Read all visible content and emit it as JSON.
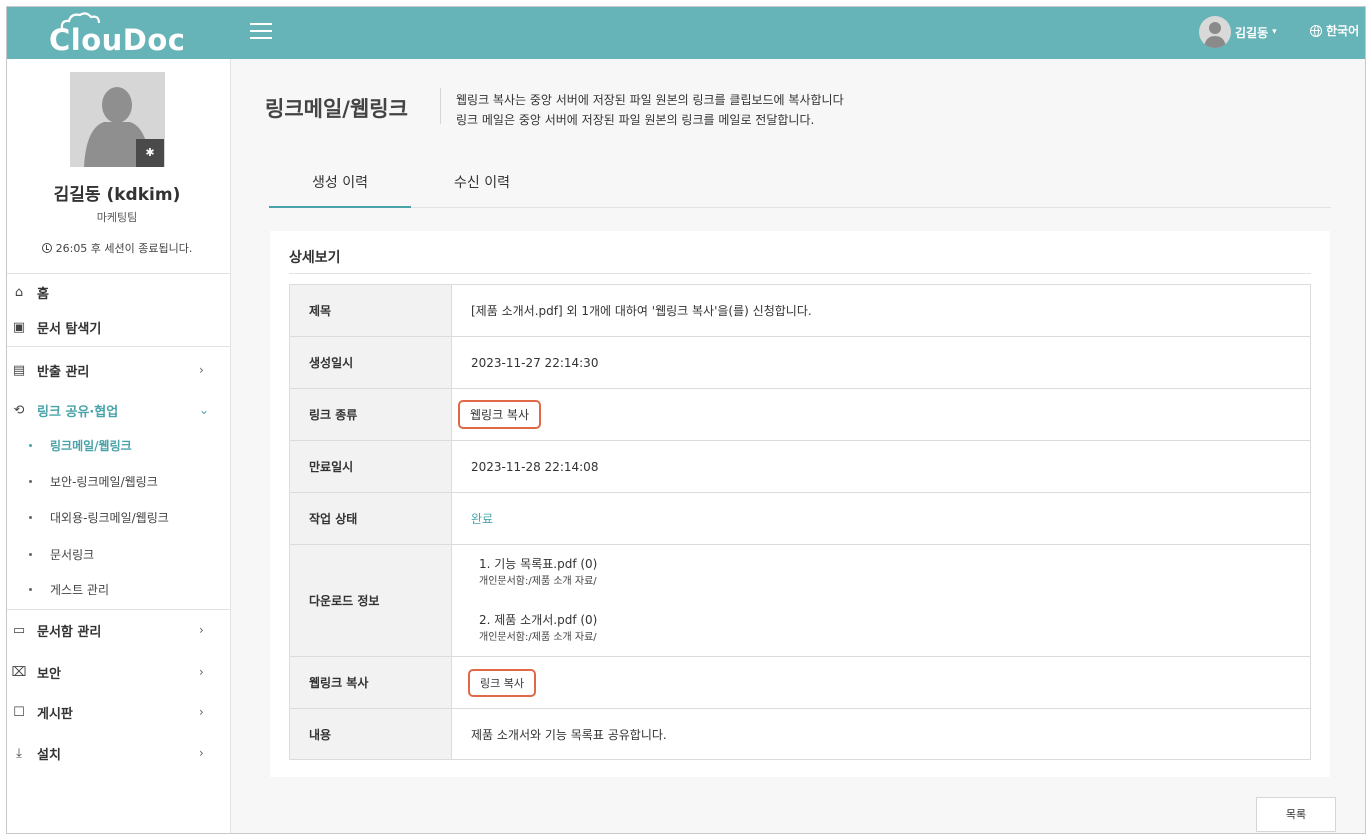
{
  "header": {
    "logo_text": "ClouDoc",
    "user_name": "김길동",
    "user_caret": "▾",
    "language": "한국어"
  },
  "profile": {
    "name": "김길동 (kdkim)",
    "team": "마케팅팀",
    "session_text": "26:05 후 세션이 종료됩니다.",
    "gear_icon": "gear-icon"
  },
  "sidebar": {
    "items": [
      {
        "label": "홈",
        "icon": "home-icon"
      },
      {
        "label": "문서 탐색기",
        "icon": "explorer-icon"
      },
      {
        "label": "반출 관리",
        "icon": "export-doc-icon",
        "chevron": "›"
      },
      {
        "label": "링크 공유·협업",
        "icon": "link-share-icon",
        "chevron": "⌄"
      },
      {
        "label": "문서함 관리",
        "icon": "folder-gear-icon",
        "chevron": "›"
      },
      {
        "label": "보안",
        "icon": "lock-icon",
        "chevron": "›"
      },
      {
        "label": "게시판",
        "icon": "board-icon",
        "chevron": "›"
      },
      {
        "label": "설치",
        "icon": "download-icon",
        "chevron": "›"
      }
    ],
    "sub_items": [
      {
        "label": "링크메일/웹링크"
      },
      {
        "label": "보안-링크메일/웹링크"
      },
      {
        "label": "대외용-링크메일/웹링크"
      },
      {
        "label": "문서링크"
      },
      {
        "label": "게스트 관리"
      }
    ]
  },
  "page": {
    "title": "링크메일/웹링크",
    "desc_line1": "웹링크 복사는 중앙 서버에 저장된 파일 원본의 링크를 클립보드에 복사합니다",
    "desc_line2": "링크 메일은 중앙 서버에 저장된 파일 원본의 링크를 메일로 전달합니다."
  },
  "tabs": [
    {
      "label": "생성 이력"
    },
    {
      "label": "수신 이력"
    }
  ],
  "detail": {
    "section_title": "상세보기",
    "rows": {
      "subject": {
        "label": "제목",
        "value": "[제품 소개서.pdf] 외 1개에 대하여 '웹링크 복사'을(를) 신청합니다."
      },
      "created": {
        "label": "생성일시",
        "value": "2023-11-27 22:14:30"
      },
      "link_type": {
        "label": "링크 종류",
        "value": "웹링크 복사"
      },
      "expires": {
        "label": "만료일시",
        "value": "2023-11-28 22:14:08"
      },
      "status": {
        "label": "작업 상태",
        "value": "완료"
      },
      "downloads": {
        "label": "다운로드 정보",
        "files": [
          {
            "name": "1. 기능 목록표.pdf (0)",
            "path": "개인문서함:/제품 소개 자료/"
          },
          {
            "name": "2. 제품 소개서.pdf (0)",
            "path": "개인문서함:/제품 소개 자료/"
          }
        ]
      },
      "weblink_copy": {
        "label": "웹링크 복사",
        "button": "링크 복사"
      },
      "content": {
        "label": "내용",
        "value": "제품 소개서와 기능 목록표 공유합니다."
      }
    },
    "list_button": "목록"
  },
  "colors": {
    "header_bg": "#66b3b8",
    "accent": "#4aa3a9",
    "highlight_border": "#e06a48"
  }
}
